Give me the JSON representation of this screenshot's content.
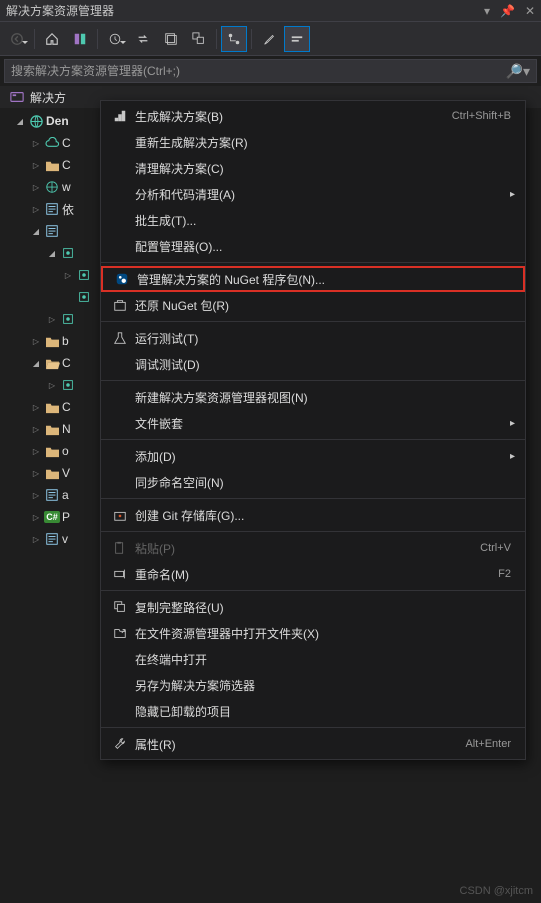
{
  "title": "解决方案资源管理器",
  "search": {
    "placeholder": "搜索解决方案资源管理器(Ctrl+;)"
  },
  "solution": {
    "label_prefix": "解决方",
    "project_name": "Den"
  },
  "tree": [
    {
      "label": "C",
      "d": 1,
      "arrow": "closed",
      "icon": "cloud"
    },
    {
      "label": "C",
      "d": 1,
      "arrow": "closed",
      "icon": "folder"
    },
    {
      "label": "w",
      "d": 1,
      "arrow": "closed",
      "icon": "globe"
    },
    {
      "label": "依",
      "d": 1,
      "arrow": "closed",
      "icon": "config"
    },
    {
      "label": "",
      "d": 1,
      "arrow": "open",
      "icon": "config"
    },
    {
      "label": "",
      "d": 2,
      "arrow": "open",
      "icon": "class"
    },
    {
      "label": "",
      "d": 3,
      "arrow": "closed",
      "icon": "class"
    },
    {
      "label": "",
      "d": 3,
      "arrow": "none",
      "icon": "class"
    },
    {
      "label": "",
      "d": 2,
      "arrow": "closed",
      "icon": "class"
    },
    {
      "label": "b",
      "d": 1,
      "arrow": "closed",
      "icon": "folder"
    },
    {
      "label": "C",
      "d": 1,
      "arrow": "open",
      "icon": "folder-open"
    },
    {
      "label": "",
      "d": 2,
      "arrow": "closed",
      "icon": "class"
    },
    {
      "label": "C",
      "d": 1,
      "arrow": "closed",
      "icon": "folder"
    },
    {
      "label": "N",
      "d": 1,
      "arrow": "closed",
      "icon": "folder"
    },
    {
      "label": "o",
      "d": 1,
      "arrow": "closed",
      "icon": "folder"
    },
    {
      "label": "V",
      "d": 1,
      "arrow": "closed",
      "icon": "folder"
    },
    {
      "label": "a",
      "d": 1,
      "arrow": "closed",
      "icon": "config"
    },
    {
      "label": "P",
      "d": 1,
      "arrow": "closed",
      "icon": "cs"
    },
    {
      "label": "v",
      "d": 1,
      "arrow": "closed",
      "icon": "config"
    }
  ],
  "menu": [
    {
      "t": "item",
      "icon": "build",
      "label": "生成解决方案(B)",
      "shortcut": "Ctrl+Shift+B"
    },
    {
      "t": "item",
      "label": "重新生成解决方案(R)"
    },
    {
      "t": "item",
      "label": "清理解决方案(C)"
    },
    {
      "t": "item",
      "label": "分析和代码清理(A)",
      "sub": true
    },
    {
      "t": "item",
      "label": "批生成(T)..."
    },
    {
      "t": "item",
      "label": "配置管理器(O)..."
    },
    {
      "t": "sep"
    },
    {
      "t": "item",
      "icon": "nuget",
      "label": "管理解决方案的 NuGet 程序包(N)...",
      "hl": true
    },
    {
      "t": "item",
      "icon": "restore",
      "label": "还原 NuGet 包(R)"
    },
    {
      "t": "sep"
    },
    {
      "t": "item",
      "icon": "flask",
      "label": "运行测试(T)"
    },
    {
      "t": "item",
      "label": "调试测试(D)"
    },
    {
      "t": "sep"
    },
    {
      "t": "item",
      "label": "新建解决方案资源管理器视图(N)"
    },
    {
      "t": "item",
      "label": "文件嵌套",
      "sub": true
    },
    {
      "t": "sep"
    },
    {
      "t": "item",
      "label": "添加(D)",
      "sub": true
    },
    {
      "t": "item",
      "label": "同步命名空间(N)"
    },
    {
      "t": "sep"
    },
    {
      "t": "item",
      "icon": "git",
      "label": "创建 Git 存储库(G)..."
    },
    {
      "t": "sep"
    },
    {
      "t": "item",
      "icon": "paste",
      "label": "粘贴(P)",
      "shortcut": "Ctrl+V",
      "disabled": true
    },
    {
      "t": "item",
      "icon": "rename",
      "label": "重命名(M)",
      "shortcut": "F2"
    },
    {
      "t": "sep"
    },
    {
      "t": "item",
      "icon": "copy",
      "label": "复制完整路径(U)"
    },
    {
      "t": "item",
      "icon": "open",
      "label": "在文件资源管理器中打开文件夹(X)"
    },
    {
      "t": "item",
      "label": "在终端中打开"
    },
    {
      "t": "item",
      "label": "另存为解决方案筛选器"
    },
    {
      "t": "item",
      "label": "隐藏已卸载的项目"
    },
    {
      "t": "sep"
    },
    {
      "t": "item",
      "icon": "wrench",
      "label": "属性(R)",
      "shortcut": "Alt+Enter"
    }
  ],
  "watermark": "CSDN @xjitcm"
}
